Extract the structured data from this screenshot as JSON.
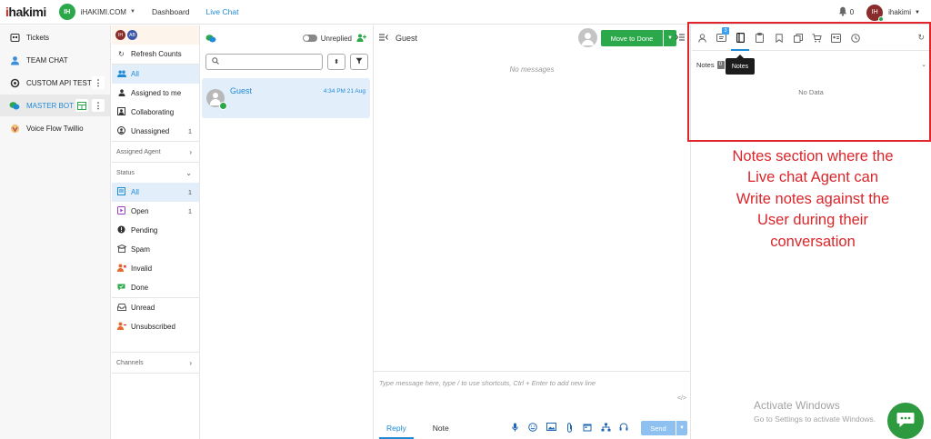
{
  "topbar": {
    "logo_prefix": "i",
    "logo_rest": "hakimi",
    "workspace_initials": "IH",
    "workspace_name": "iHAKIMI.COM",
    "nav": [
      {
        "label": "Dashboard",
        "active": false
      },
      {
        "label": "Live Chat",
        "active": true
      }
    ],
    "notification_count": "0",
    "user_initials": "IH",
    "user_name": "ihakimi"
  },
  "leftnav": {
    "items": [
      {
        "label": "Tickets",
        "icon": "tickets-icon"
      },
      {
        "label": "TEAM CHAT",
        "icon": "user-icon"
      },
      {
        "label": "CUSTOM API TEST",
        "icon": "whatsapp-icon"
      },
      {
        "label": "MASTER BOT",
        "icon": "livechat-icon",
        "active": true
      },
      {
        "label": "Voice Flow Twillio",
        "icon": "voiceflow-icon"
      }
    ]
  },
  "filters": {
    "avatar_initials": [
      "IH",
      "AB"
    ],
    "refresh_label": "Refresh Counts",
    "inbox": [
      {
        "label": "All",
        "count": "",
        "selected": true
      },
      {
        "label": "Assigned to me",
        "count": ""
      },
      {
        "label": "Collaborating",
        "count": ""
      },
      {
        "label": "Unassigned",
        "count": "1"
      }
    ],
    "assigned_agent_label": "Assigned Agent",
    "status_label": "Status",
    "status": [
      {
        "label": "All",
        "count": "1",
        "selected": true
      },
      {
        "label": "Open",
        "count": "1"
      },
      {
        "label": "Pending",
        "count": ""
      },
      {
        "label": "Spam",
        "count": ""
      },
      {
        "label": "Invalid",
        "count": ""
      },
      {
        "label": "Done",
        "count": ""
      }
    ],
    "extra": [
      {
        "label": "Unread"
      },
      {
        "label": "Unsubscribed"
      }
    ],
    "channels_label": "Channels"
  },
  "conversations": {
    "unreplied_label": "Unreplied",
    "search_placeholder": "",
    "items": [
      {
        "name": "Guest",
        "time": "4:34 PM 21 Aug"
      }
    ]
  },
  "chat": {
    "title": "Guest",
    "move_to_done_label": "Move to Done",
    "empty_text": "No messages",
    "composer_placeholder": "Type message here, type / to use shortcuts, Ctrl + Enter to add new line",
    "tab_reply": "Reply",
    "tab_note": "Note",
    "send_label": "Send"
  },
  "rightpanel": {
    "notes_badge": "3",
    "notes_label": "Notes",
    "notes_count": "0",
    "tooltip": "Notes",
    "empty_text": "No Data"
  },
  "annotation": {
    "lines": [
      "Notes section where the",
      "Live chat Agent can",
      "Write  notes  against the",
      "User during  their",
      "conversation"
    ]
  },
  "watermark": {
    "title": "Activate Windows",
    "subtitle": "Go to Settings to activate Windows."
  },
  "colors": {
    "accent": "#1f8ad6",
    "brand_green": "#2aa84a",
    "annotation_red": "#e0262c",
    "selected_bg": "#e3eefb"
  }
}
